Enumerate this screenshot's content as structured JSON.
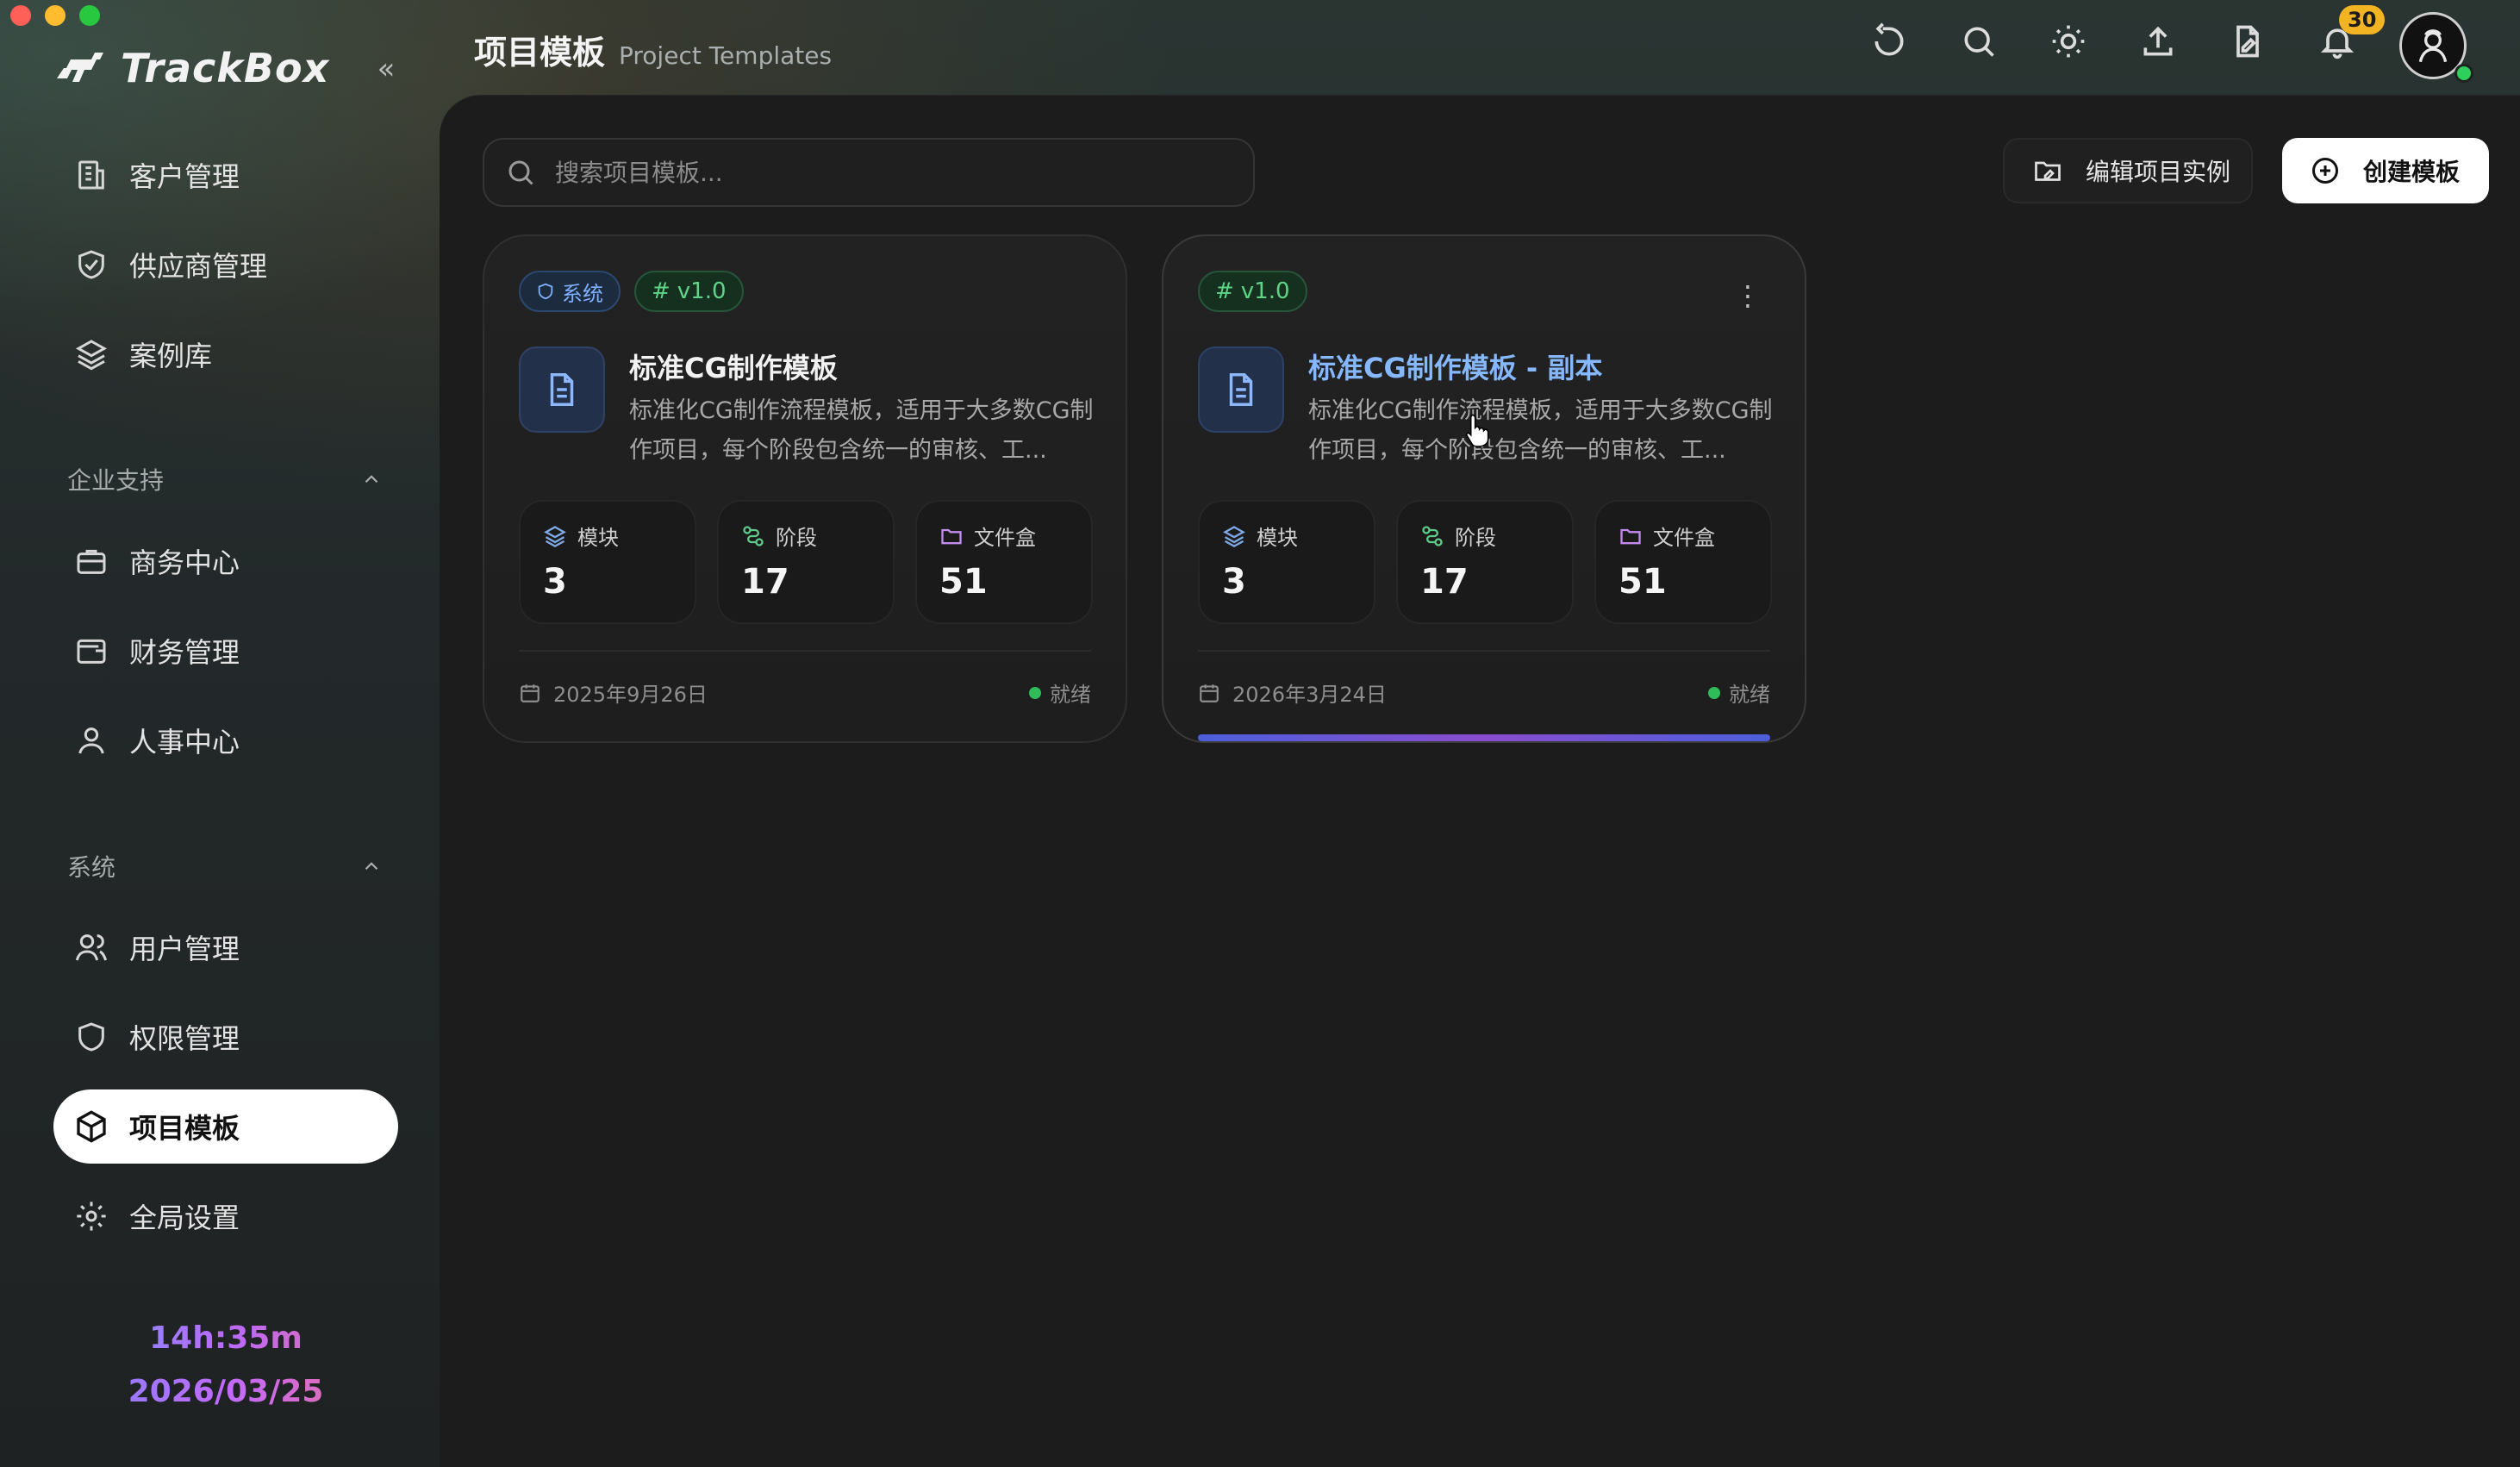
{
  "app": {
    "name": "TrackBox"
  },
  "sidebar": {
    "collapse_icon": "chevrons-left-icon",
    "items_top": [
      {
        "label": "客户管理",
        "icon": "building-icon"
      },
      {
        "label": "供应商管理",
        "icon": "handshake-shield-icon"
      },
      {
        "label": "案例库",
        "icon": "layers-icon"
      }
    ],
    "section_enterprise": {
      "title": "企业支持",
      "items": [
        {
          "label": "商务中心",
          "icon": "briefcase-icon"
        },
        {
          "label": "财务管理",
          "icon": "wallet-icon"
        },
        {
          "label": "人事中心",
          "icon": "user-icon"
        }
      ]
    },
    "section_system": {
      "title": "系统",
      "items": [
        {
          "label": "用户管理",
          "icon": "users-icon"
        },
        {
          "label": "权限管理",
          "icon": "shield-icon"
        },
        {
          "label": "项目模板",
          "icon": "box-icon",
          "active": true
        },
        {
          "label": "全局设置",
          "icon": "gear-icon"
        }
      ]
    },
    "clock": {
      "time": "14h:35m",
      "date": "2026/03/25"
    }
  },
  "header": {
    "title": "项目模板",
    "subtitle": "Project Templates",
    "icons": [
      "refresh-icon",
      "search-icon",
      "sun-icon",
      "upload-icon",
      "file-edit-icon",
      "bell-icon"
    ],
    "notification_count": "30",
    "avatar_icon": "avatar-icon"
  },
  "toolbar": {
    "search_placeholder": "搜索项目模板...",
    "edit_instance_label": "编辑项目实例",
    "create_template_label": "创建模板"
  },
  "templates": [
    {
      "system_tag": "系统",
      "version": "v1.0",
      "title": "标准CG制作模板",
      "description": "标准化CG制作流程模板，适用于大多数CG制作项目，每个阶段包含统一的审核、工...",
      "stats": [
        {
          "label": "模块",
          "value": "3",
          "icon": "layers-icon",
          "color": "#7fa9e6"
        },
        {
          "label": "阶段",
          "value": "17",
          "icon": "route-icon",
          "color": "#5fc98a"
        },
        {
          "label": "文件盒",
          "value": "51",
          "icon": "folder-icon",
          "color": "#c38bf0"
        }
      ],
      "date": "2025年9月26日",
      "status": "就绪"
    },
    {
      "version": "v1.0",
      "title": "标准CG制作模板 - 副本",
      "description": "标准化CG制作流程模板，适用于大多数CG制作项目，每个阶段包含统一的审核、工...",
      "stats": [
        {
          "label": "模块",
          "value": "3",
          "icon": "layers-icon",
          "color": "#7fa9e6"
        },
        {
          "label": "阶段",
          "value": "17",
          "icon": "route-icon",
          "color": "#5fc98a"
        },
        {
          "label": "文件盒",
          "value": "51",
          "icon": "folder-icon",
          "color": "#c38bf0"
        }
      ],
      "date": "2026年3月24日",
      "status": "就绪"
    }
  ]
}
